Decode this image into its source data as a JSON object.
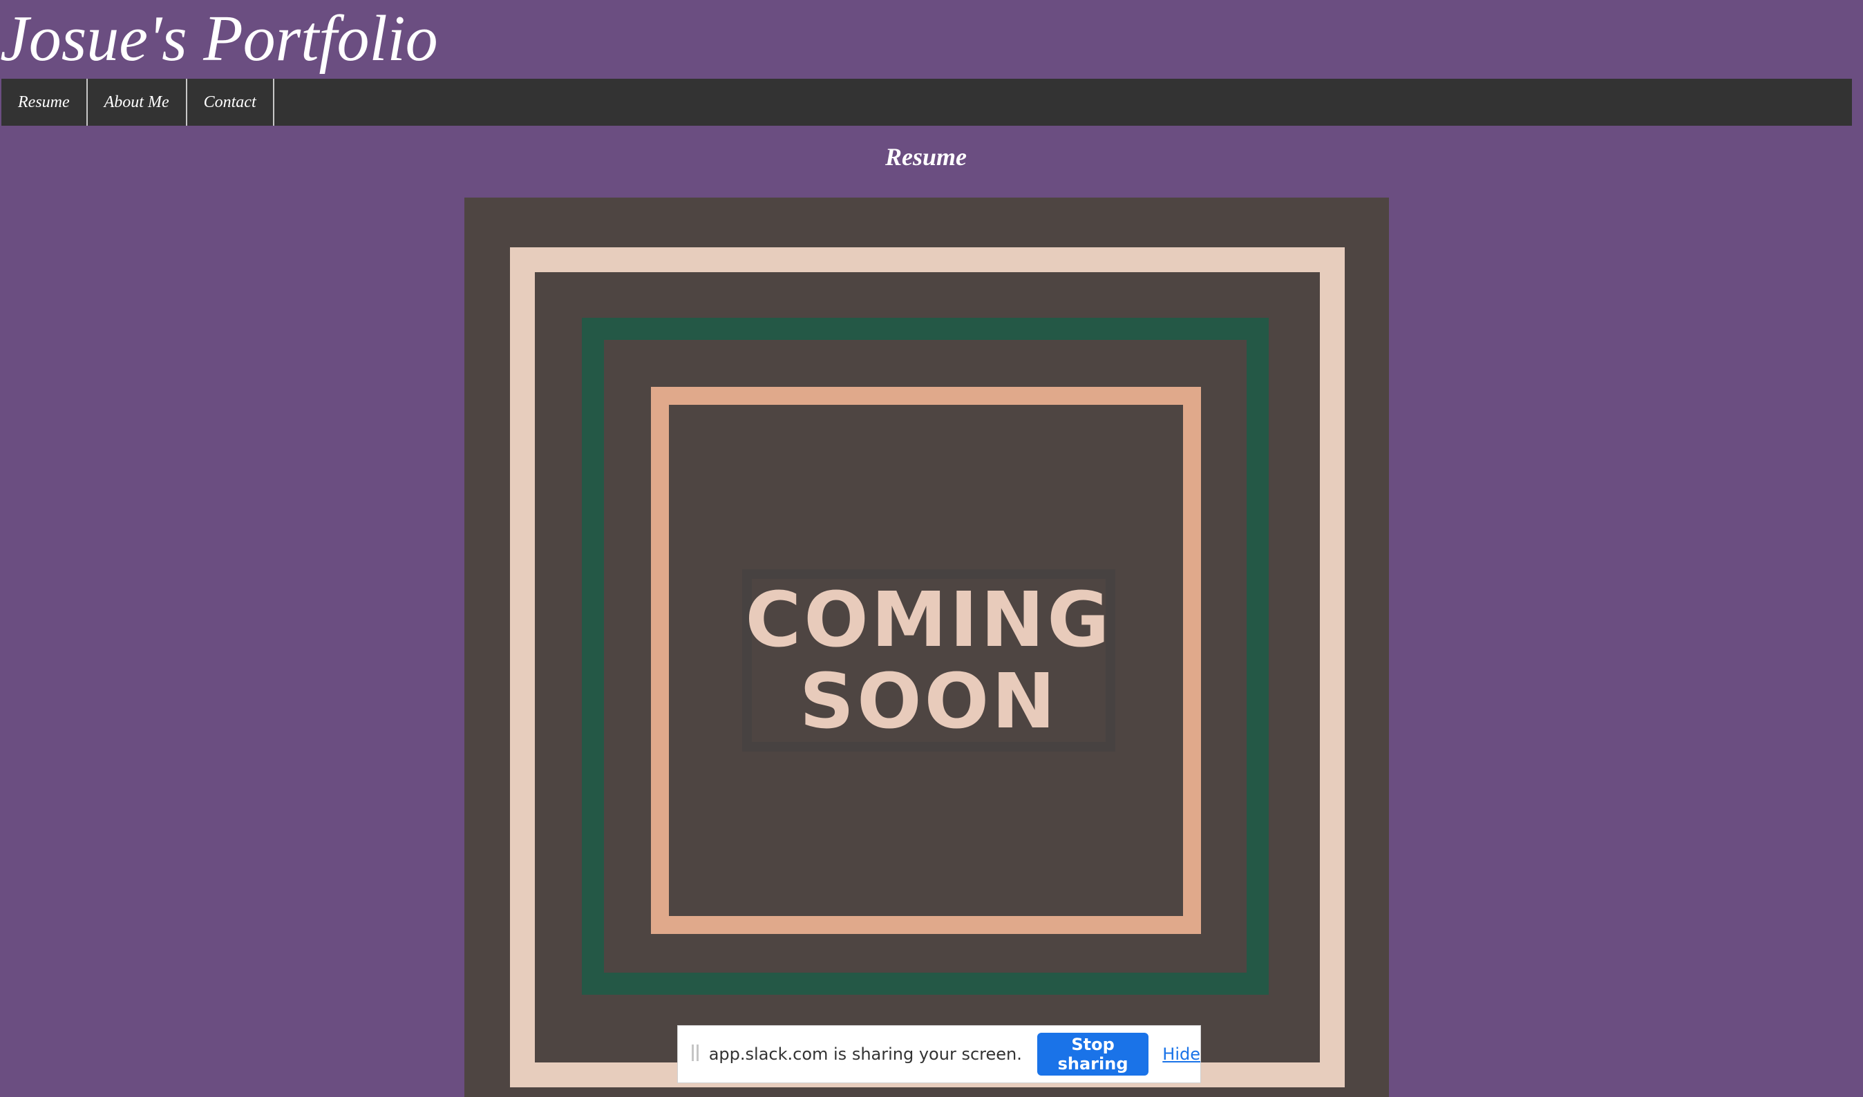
{
  "site": {
    "title": "Josue's Portfolio"
  },
  "nav": {
    "items": [
      {
        "label": "Resume"
      },
      {
        "label": "About Me"
      },
      {
        "label": "Contact"
      }
    ]
  },
  "main": {
    "heading": "Resume",
    "poster": {
      "line1": "COMING",
      "line2": "SOON"
    }
  },
  "share_bar": {
    "message": "app.slack.com is sharing your screen.",
    "stop_label": "Stop sharing",
    "hide_label": "Hide"
  },
  "colors": {
    "page_background": "#6b4e81",
    "nav_background": "#333333",
    "poster_background": "#4e4542",
    "frame_outer": "#e7cdbd",
    "frame_middle": "#245846",
    "frame_inner": "#e0a98b",
    "stop_button": "#1a73e8"
  }
}
